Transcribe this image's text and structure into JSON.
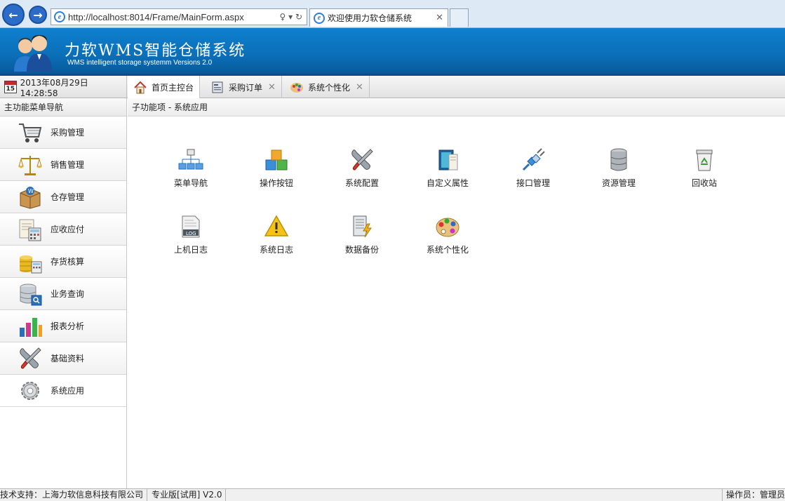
{
  "browser": {
    "url": "http://localhost:8014/Frame/MainForm.aspx",
    "tab_title": "欢迎使用力软仓储系统",
    "tools": "♀ ▾ ↻"
  },
  "header": {
    "title": "力软WMS智能仓储系统",
    "subtitle": "WMS intelligent storage systemm Versions 2.0"
  },
  "tabbar": {
    "calendar_day": "15",
    "datetime": "2013年08月29日 14:28:58",
    "tabs": [
      {
        "label": "首页主控台",
        "icon": "home-icon"
      },
      {
        "label": "采购订单",
        "icon": "order-icon"
      },
      {
        "label": "系统个性化",
        "icon": "palette-icon"
      }
    ],
    "close_glyph": "✕"
  },
  "sidebar": {
    "title": "主功能菜单导航",
    "items": [
      {
        "label": "采购管理",
        "icon": "shopping-cart-icon"
      },
      {
        "label": "销售管理",
        "icon": "scales-icon"
      },
      {
        "label": "仓存管理",
        "icon": "warehouse-box-icon"
      },
      {
        "label": "应收应付",
        "icon": "calculator-icon"
      },
      {
        "label": "存货核算",
        "icon": "coins-icon"
      },
      {
        "label": "业务查询",
        "icon": "database-search-icon"
      },
      {
        "label": "报表分析",
        "icon": "bar-chart-icon"
      },
      {
        "label": "基础资料",
        "icon": "tools-icon"
      },
      {
        "label": "系统应用",
        "icon": "gear-icon"
      }
    ],
    "active_index": 8
  },
  "main": {
    "breadcrumb": "子功能项 - 系统应用",
    "items": [
      {
        "label": "菜单导航",
        "icon": "sitemap-icon"
      },
      {
        "label": "操作按钮",
        "icon": "blocks-icon"
      },
      {
        "label": "系统配置",
        "icon": "tools-icon"
      },
      {
        "label": "自定义属性",
        "icon": "book-icon"
      },
      {
        "label": "接口管理",
        "icon": "plug-icon"
      },
      {
        "label": "资源管理",
        "icon": "database-icon"
      },
      {
        "label": "回收站",
        "icon": "recycle-bin-icon"
      },
      {
        "label": "上机日志",
        "icon": "log-file-icon"
      },
      {
        "label": "系统日志",
        "icon": "warning-icon"
      },
      {
        "label": "数据备份",
        "icon": "backup-icon"
      },
      {
        "label": "系统个性化",
        "icon": "palette-icon"
      }
    ]
  },
  "status": {
    "support": "技术支持：上海力软信息科技有限公司",
    "edition": "专业版[试用] V2.0",
    "operator": "操作员：管理员"
  },
  "colors": {
    "header_blue": "#0b6fb8",
    "header_dark": "#08599a",
    "browser_blue": "#2b6cc8"
  }
}
